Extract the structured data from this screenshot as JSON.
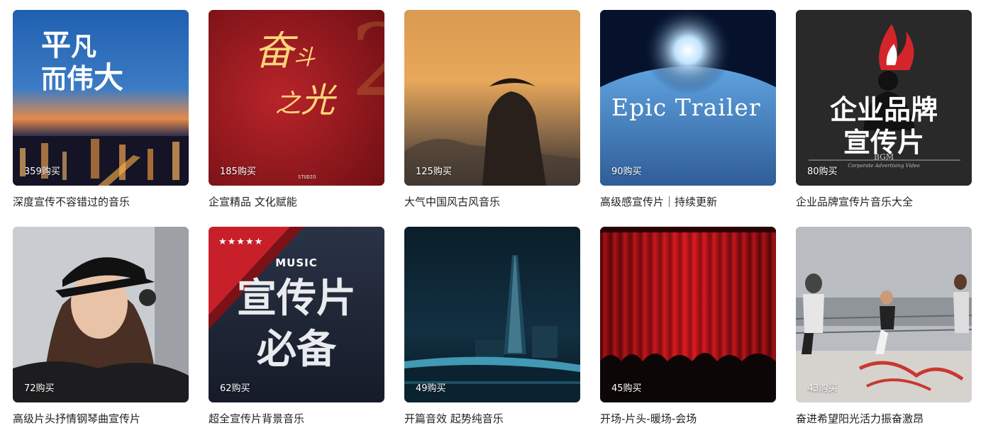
{
  "playlists": [
    {
      "title": "深度宣传不容错过的音乐",
      "count": "359购买",
      "art_text": [
        "平",
        "凡",
        "而",
        "伟",
        "大"
      ]
    },
    {
      "title": "企宣精品 文化赋能",
      "count": "185购买",
      "art_text": [
        "奋",
        "斗",
        "之",
        "光"
      ],
      "art_logo": "STUDIO"
    },
    {
      "title": "大气中国风古风音乐",
      "count": "125购买"
    },
    {
      "title": "高级感宣传片｜持续更新",
      "count": "90购买",
      "art_text": "Epic Trailer"
    },
    {
      "title": "企业品牌宣传片音乐大全",
      "count": "80购买",
      "art_text": [
        "企业品牌",
        "宣传片"
      ],
      "art_sub": "BGM",
      "art_sub2": "Corporate Advertising Video"
    },
    {
      "title": "高级片头抒情钢琴曲宣传片",
      "count": "72购买"
    },
    {
      "title": "超全宣传片背景音乐",
      "count": "62购买",
      "art_text": [
        "宣传片",
        "必备"
      ],
      "art_badge": "MUSIC",
      "art_stars": "★★★★★"
    },
    {
      "title": "开篇音效 起势纯音乐",
      "count": "49购买"
    },
    {
      "title": "开场-片头-暖场-会场",
      "count": "45购买"
    },
    {
      "title": "奋进希望阳光活力振奋激昂",
      "count": "43购买"
    }
  ]
}
